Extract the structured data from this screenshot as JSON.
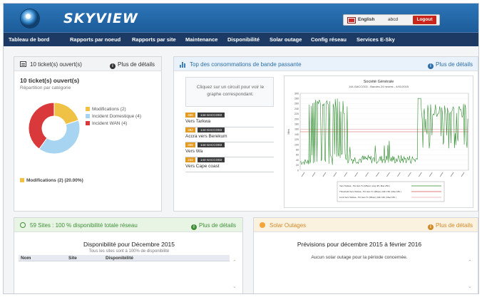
{
  "app": {
    "name": "SKYVIEW"
  },
  "header": {
    "language": "English",
    "user": "abcd",
    "logout": "Logout"
  },
  "nav": [
    "Tableau de bord",
    "Rapports par noeud",
    "Rapports par site",
    "Maintenance",
    "Disponibilité",
    "Solar outage",
    "Config réseau",
    "Services E-Sky"
  ],
  "tickets": {
    "title": "10 ticket(s) ouvert(s)",
    "link": "Plus de détails",
    "big": "10 ticket(s) ouvert(s)",
    "sub": "Répartition par catégorie",
    "legend": [
      {
        "label": "Modifications (2)",
        "color": "#efc145"
      },
      {
        "label": "Incident Domestique (4)",
        "color": "#a6d4f1"
      },
      {
        "label": "Incident WAN (4)",
        "color": "#d9393b"
      }
    ],
    "footer": "Modifications (2) (20.00%)"
  },
  "bandwidth": {
    "title": "Top des consommations de bande passante",
    "link": "Plus de détails",
    "hint": "Cliquez sur un circuit pour voir le graphe correspondant.",
    "circuits": [
      {
        "value": "455",
        "code": "144-SACCO03",
        "name": "Vers Tarkwa"
      },
      {
        "value": "382",
        "code": "144-SACCO03",
        "name": "Accra vers Berekum"
      },
      {
        "value": "306",
        "code": "144-SACCO03",
        "name": "Vers Wa"
      },
      {
        "value": "232",
        "code": "144-SACCO03",
        "name": "Vers Cape coast"
      }
    ]
  },
  "chart_data": {
    "type": "line",
    "title": "Société Générale",
    "subtitle": "144-SACCO03 - Bandes 24 heures - 4/01/2015",
    "ylabel": "Mbs",
    "ylim": [
      0,
      300
    ],
    "yticks": [
      0,
      20,
      40,
      60,
      80,
      100,
      120,
      140,
      160,
      180,
      200,
      220,
      240,
      260,
      280,
      300
    ],
    "legend_items": [
      "Vers Tarkwa - Pic Han Tx (Mbps) | Avg 48 | Max 250 |",
      "Threshold Vers Tarkwa - Pic Han Tx (Mbps) | Min 150 | Max 150 |",
      "Limit Vers Tarkwa - Pic Han Tx (Mbps) | Min 160 | Max 160 |"
    ],
    "threshold": 150,
    "limit": 160,
    "colors": {
      "series": "#2e8b2e",
      "threshold": "#d64f4f",
      "limit": "#e8a7a7"
    }
  },
  "sites": {
    "title": "59 Sites : 100 % disponibilité totale réseau",
    "link": "Plus de détails",
    "heading": "Disponibilité pour Décembre 2015",
    "subheading": "Tous les sites sont à 100% de disponibilité",
    "columns": [
      "Nom",
      "Site",
      "Disponibilité"
    ]
  },
  "solar": {
    "title": "Solar Outages",
    "link": "Plus de détails",
    "heading": "Prévisions pour décembre 2015 à février 2016",
    "message": "Aucun solar outage pour la période concernée."
  },
  "colors": {
    "header": "#2469aa",
    "nav": "#1c3a63",
    "logout": "#c8261b"
  }
}
